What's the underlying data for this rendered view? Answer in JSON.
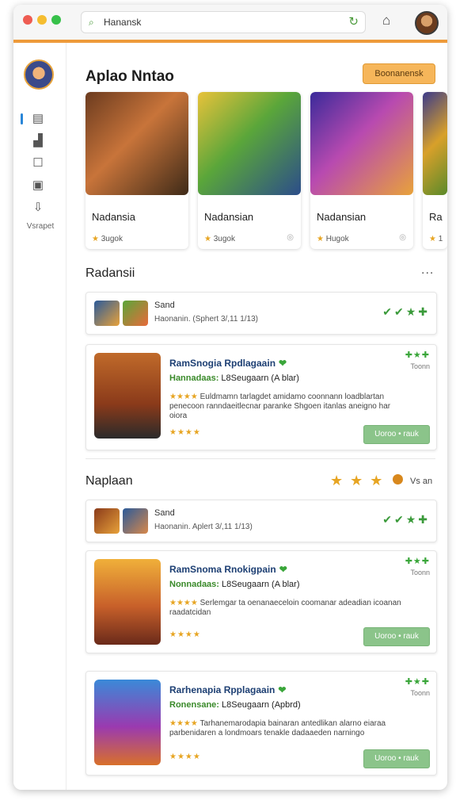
{
  "browser": {
    "address": "Hanansk",
    "colors": {
      "close": "#ee5c52",
      "minimize": "#f5bd2f",
      "maximize": "#37c14a",
      "accent": "#ee9a3a"
    }
  },
  "sidebar": {
    "label": "Vsrapet"
  },
  "header": {
    "title": "Aplao Nntao",
    "button": "Boonanensk"
  },
  "featured": [
    {
      "title": "Nadansia",
      "meta": "3ugok"
    },
    {
      "title": "Nadansian",
      "meta": "3ugok"
    },
    {
      "title": "Nadansian",
      "meta": "Hugok"
    },
    {
      "title": "Ra",
      "meta": "1"
    }
  ],
  "section1": {
    "title": "Radansii",
    "more": "...",
    "mini": {
      "title": "Sand",
      "sub": "Haonanin. (Sphert 3/,11 1/13)"
    },
    "app": {
      "title": "RamSnogia Rpdlagaain",
      "sub_label": "Hannadaas:",
      "sub_value": "L8Seugaarn (A blar)",
      "desc": "Euldmamn tarlagdet amidamo coonnann loadblartan penecoon ranndaeitlecnar paranke Shgoen itanlas aneigno har oiora",
      "rating_label": "Toonn",
      "button": "Uoroo • rauk"
    }
  },
  "section2": {
    "title": "Naplaan",
    "rating": "Vs an",
    "mini": {
      "title": "Sand",
      "sub": "Haonanin. Aplert 3/,11 1/13)"
    },
    "apps": [
      {
        "title": "RamSnoma Rnokigpain",
        "sub_label": "Nonnadaas:",
        "sub_value": "L8Seugaarn (A blar)",
        "desc": "Serlemgar ta oenanaeceloin coomanar adeadian icoanan raadatcidan",
        "rating_label": "Toonn",
        "button": "Uoroo • rauk"
      },
      {
        "title": "Rarhenapia Rpplagaain",
        "sub_label": "Ronensane:",
        "sub_value": "L8Seugaarn (Apbrd)",
        "desc": "Tarhanemarodapia bainaran antedlikan alarno eiaraa parbenidaren a londmoars tenakle dadaaeden narningo",
        "rating_label": "Toonn",
        "button": "Uoroo • rauk"
      }
    ]
  }
}
